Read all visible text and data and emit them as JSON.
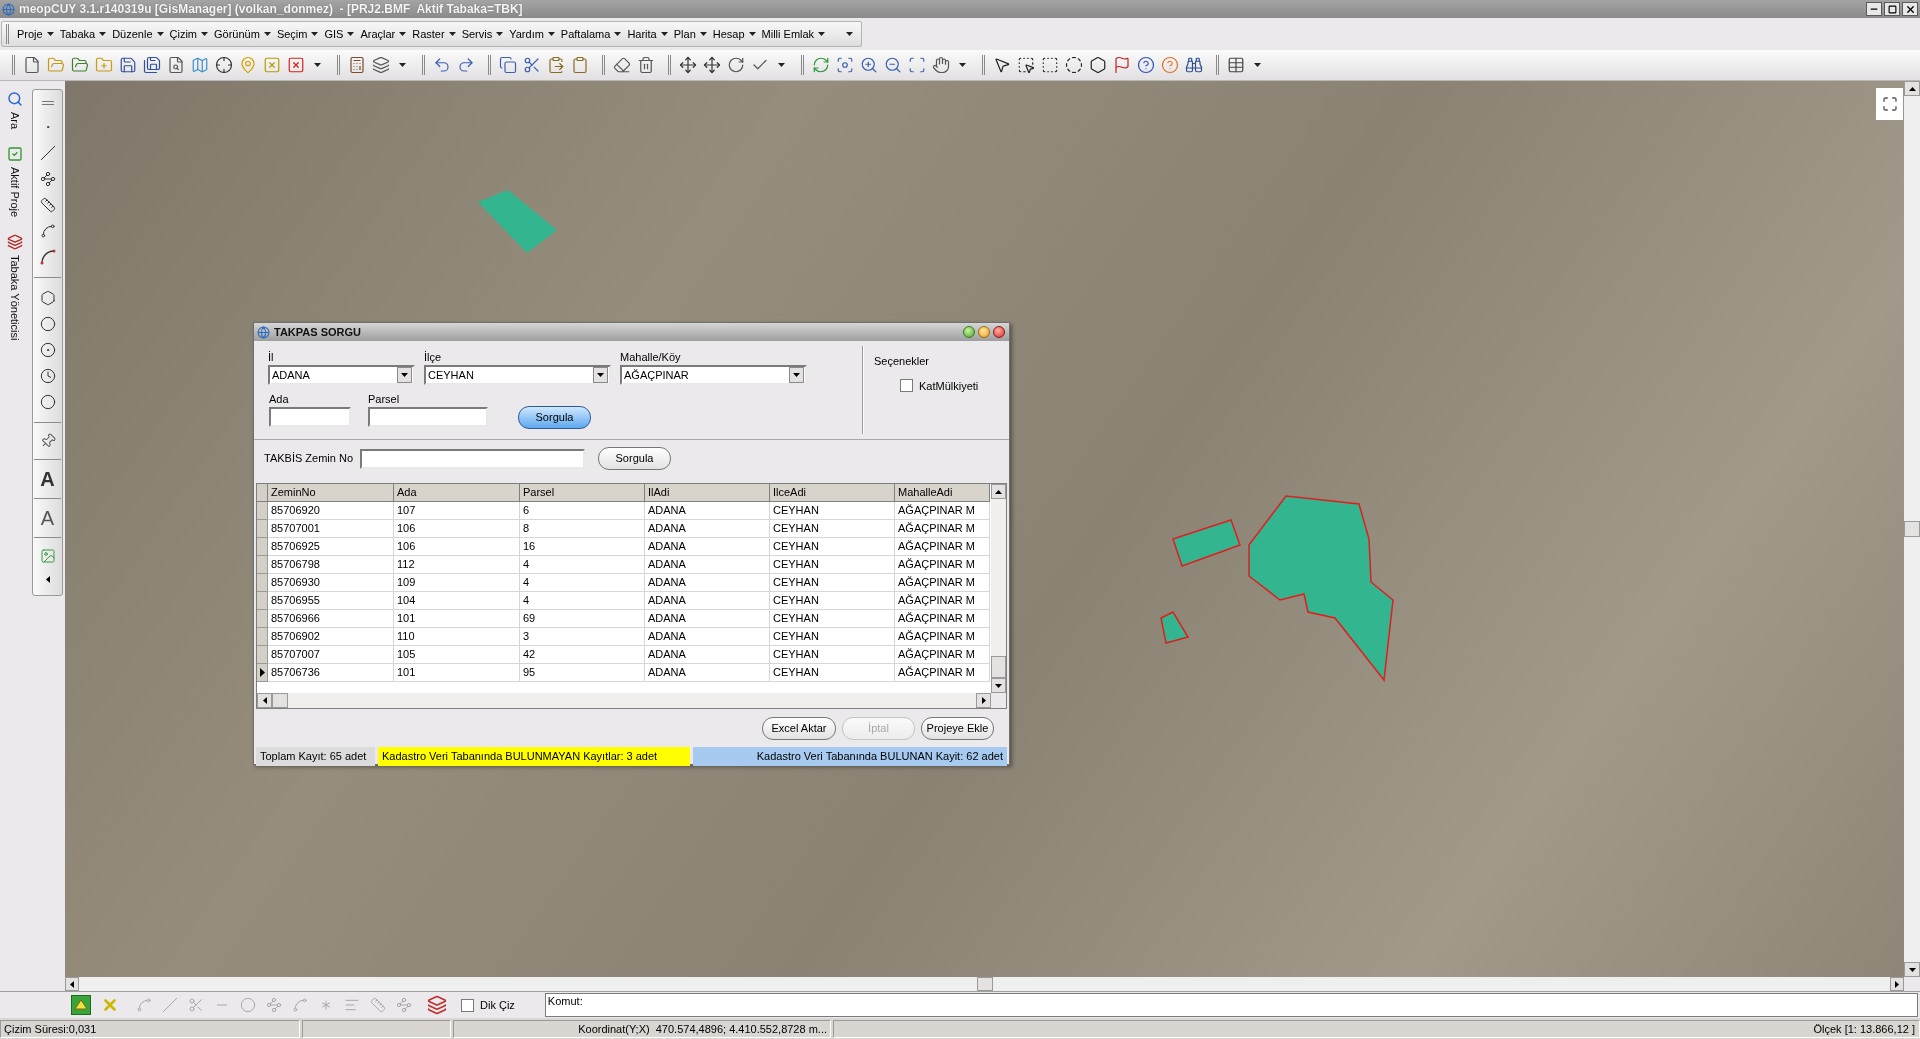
{
  "window": {
    "title": "meopCUY 3.1.r140319u [GisManager] (volkan_donmez)  - [PRJ2.BMF  Aktif Tabaka=TBK]"
  },
  "menu": [
    "Proje",
    "Tabaka",
    "Düzenle",
    "Çizim",
    "Görünüm",
    "Seçim",
    "GIS",
    "Araçlar",
    "Raster",
    "Servis",
    "Yardım",
    "Paftalama",
    "Harita",
    "Plan",
    "Hesap",
    "Milli Emlak"
  ],
  "side_tabs": [
    {
      "label": "Ara",
      "kind": "search"
    },
    {
      "label": "Aktif Proje",
      "kind": "project"
    },
    {
      "label": "Tabaka Yöneticisi",
      "kind": "layers"
    }
  ],
  "drawing_tools": {
    "text_tools": [
      {
        "label": "A",
        "kind": "text"
      },
      {
        "label": "A",
        "kind": "attribute"
      }
    ]
  },
  "dialog": {
    "title": "TAKPAS SORGU",
    "selectors": [
      {
        "label": "İl",
        "value": "ADANA"
      },
      {
        "label": "İlçe",
        "value": "CEYHAN"
      },
      {
        "label": "Mahalle/Köy",
        "value": "AĞAÇPINAR"
      }
    ],
    "inputs": [
      {
        "label": "Ada"
      },
      {
        "label": "Parsel"
      }
    ],
    "query_button": {
      "label": "Sorgula",
      "focused": true
    },
    "options": {
      "title": "Seçenekler",
      "items": [
        {
          "label": "KatMülkiyeti",
          "checked": false
        }
      ]
    },
    "takbis": {
      "label": "TAKBİS Zemin No",
      "button": {
        "label": "Sorgula",
        "focused": false
      }
    },
    "table": {
      "columns": [
        "ZeminNo",
        "Ada",
        "Parsel",
        "IlAdi",
        "IlceAdi",
        "MahalleAdi"
      ],
      "rows": [
        {
          "cells": [
            "85706920",
            "107",
            "6",
            "ADANA",
            "CEYHAN",
            "AĞAÇPINAR M"
          ],
          "selected": false
        },
        {
          "cells": [
            "85707001",
            "106",
            "8",
            "ADANA",
            "CEYHAN",
            "AĞAÇPINAR M"
          ],
          "selected": false
        },
        {
          "cells": [
            "85706925",
            "106",
            "16",
            "ADANA",
            "CEYHAN",
            "AĞAÇPINAR M"
          ],
          "selected": false
        },
        {
          "cells": [
            "85706798",
            "112",
            "4",
            "ADANA",
            "CEYHAN",
            "AĞAÇPINAR M"
          ],
          "selected": false
        },
        {
          "cells": [
            "85706930",
            "109",
            "4",
            "ADANA",
            "CEYHAN",
            "AĞAÇPINAR M"
          ],
          "selected": false
        },
        {
          "cells": [
            "85706955",
            "104",
            "4",
            "ADANA",
            "CEYHAN",
            "AĞAÇPINAR M"
          ],
          "selected": false
        },
        {
          "cells": [
            "85706966",
            "101",
            "69",
            "ADANA",
            "CEYHAN",
            "AĞAÇPINAR M"
          ],
          "selected": false
        },
        {
          "cells": [
            "85706902",
            "110",
            "3",
            "ADANA",
            "CEYHAN",
            "AĞAÇPINAR M"
          ],
          "selected": false
        },
        {
          "cells": [
            "85707007",
            "105",
            "42",
            "ADANA",
            "CEYHAN",
            "AĞAÇPINAR M"
          ],
          "selected": false
        },
        {
          "cells": [
            "85706736",
            "101",
            "95",
            "ADANA",
            "CEYHAN",
            "AĞAÇPINAR M"
          ],
          "selected": true
        }
      ]
    },
    "actions": [
      {
        "label": "Excel Aktar",
        "disabled": false
      },
      {
        "label": "İptal",
        "disabled": true
      },
      {
        "label": "Projeye Ekle",
        "disabled": false
      }
    ],
    "status": [
      {
        "text": "Toplam Kayıt: 65 adet",
        "kind": "total",
        "color": "#dcdcdc"
      },
      {
        "text": "Kadastro Veri Tabanında BULUNMAYAN Kayıtlar: 3 adet",
        "kind": "missing",
        "color": "#ffff00"
      },
      {
        "text": "Kadastro Veri Tabanında BULUNAN Kayit: 62 adet",
        "kind": "found",
        "color": "#a6caf0"
      }
    ]
  },
  "bottom_toolbar": {
    "orthogonal": {
      "label": "Dik Çiz",
      "checked": false
    },
    "command": {
      "prompt": "Komut:"
    }
  },
  "status_bar": {
    "draw_time": "Çizim Süresi:0,031",
    "coordinates": "Koordinat(Y;X)  470.574,4896; 4.410.552,8728 m...",
    "scale": "Ölçek [1: 13.866,12 ]"
  }
}
